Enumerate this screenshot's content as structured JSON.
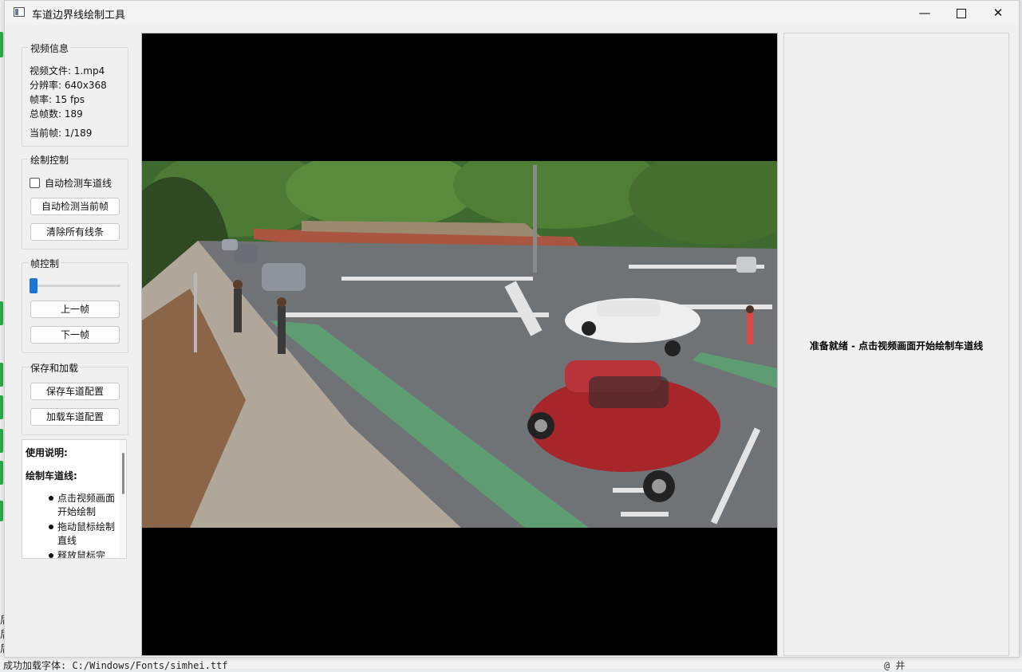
{
  "window": {
    "title": "车道边界线绘制工具",
    "controls": {
      "minimize": "—",
      "close": "✕"
    }
  },
  "video_info": {
    "group_title": "视频信息",
    "file": "视频文件: 1.mp4",
    "resolution": "分辨率: 640x368",
    "fps": "帧率: 15 fps",
    "total_frames": "总帧数: 189",
    "current_frame": "当前帧: 1/189"
  },
  "draw_control": {
    "group_title": "绘制控制",
    "auto_detect_checkbox": "自动检测车道线",
    "auto_detect_checked": false,
    "auto_detect_button": "自动检测当前帧",
    "clear_button": "清除所有线条"
  },
  "frame_control": {
    "group_title": "帧控制",
    "slider_value": 1,
    "slider_max": 189,
    "prev_button": "上一帧",
    "next_button": "下一帧"
  },
  "save_load": {
    "group_title": "保存和加载",
    "save_button": "保存车道配置",
    "load_button": "加载车道配置"
  },
  "instructions": {
    "title": "使用说明:",
    "section": "绘制车道线:",
    "items": [
      "点击视频画面开始绘制",
      "拖动鼠标绘制直线",
      "释放鼠标完"
    ]
  },
  "status": {
    "text": "准备就绪 - 点击视频画面开始绘制车道线"
  },
  "background": {
    "console_line": "成功加载字体: C:/Windows/Fonts/simhei.ttf",
    "right_chars": "@  井",
    "left_chars": [
      "后",
      "后",
      "后"
    ]
  },
  "colors": {
    "accent": "#1e74d6",
    "window_bg": "#f0f0f0",
    "video_bg": "#000000"
  }
}
